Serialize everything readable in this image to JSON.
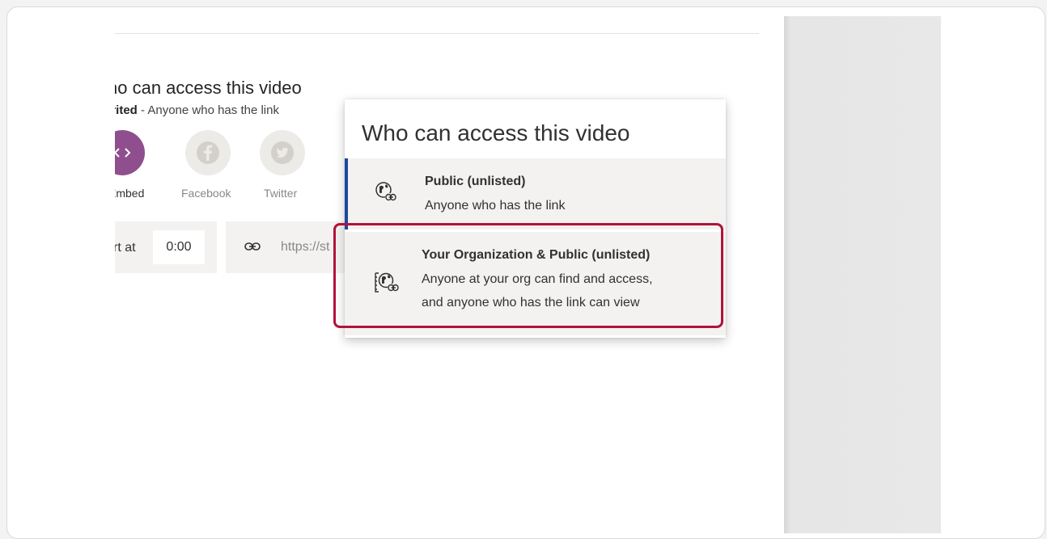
{
  "section": {
    "title": "ho can access this video",
    "subtitle_bold": "erited",
    "subtitle_rest": " - Anyone who has the link"
  },
  "share": {
    "embed_label": "Embed",
    "facebook_label": "Facebook",
    "twitter_label": "Twitter"
  },
  "start_at": {
    "label": "rt at",
    "value": "0:00"
  },
  "link": {
    "url": "https://st"
  },
  "dropdown": {
    "title": "Who can access this video",
    "options": [
      {
        "title": "Public (unlisted)",
        "desc_line1": "Anyone who has the link",
        "desc_line2": "",
        "icon": "globe-link-icon"
      },
      {
        "title": "Your Organization & Public (unlisted)",
        "desc_line1": "Anyone at your org can find and access,",
        "desc_line2": "and anyone who has the link can view",
        "icon": "org-globe-link-icon"
      }
    ]
  },
  "colors": {
    "embed_purple": "#8f4f8e",
    "selected_accent": "#1e47a0",
    "highlight_red": "#b0133a"
  }
}
